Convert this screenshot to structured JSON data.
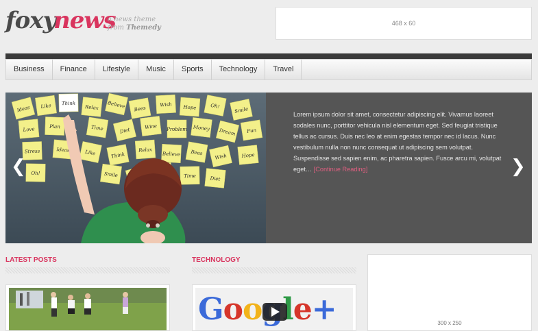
{
  "header": {
    "logo_part1": "foxy",
    "logo_part2": "news",
    "tagline_line1": "a news theme",
    "tagline_from": "from",
    "tagline_brand": "Themedy",
    "ad_label": "468 x 60"
  },
  "nav": {
    "items": [
      "Business",
      "Finance",
      "Lifestyle",
      "Music",
      "Sports",
      "Technology",
      "Travel"
    ]
  },
  "slider": {
    "excerpt": "Lorem ipsum dolor sit amet, consectetur adipiscing elit. Vivamus laoreet sodales nunc, porttitor vehicula nisl elementum eget. Sed feugiat tristique tellus ac cursus. Duis nec leo at enim egestas tempor nec id lacus. Nunc vestibulum nulla non nunc consequat ut adipiscing sem volutpat. Suspendisse sed sapien enim, ac pharetra sapien. Fusce arcu mi, volutpat eget…",
    "more_label": "[Continue Reading]",
    "note_words": [
      "Ideas",
      "Like",
      "Think",
      "Relax",
      "Believe",
      "Bees",
      "Wish",
      "Hope",
      "Oh!",
      "Smile",
      "Love",
      "Plan",
      "Time",
      "Diet",
      "Wine",
      "Problem",
      "Money",
      "Dream",
      "Fun",
      "Stress"
    ]
  },
  "sections": {
    "latest": "LATEST POSTS",
    "technology": "TECHNOLOGY"
  },
  "thumb2": {
    "brand": "Google+"
  },
  "ad_side": {
    "label": "300 x 250"
  }
}
